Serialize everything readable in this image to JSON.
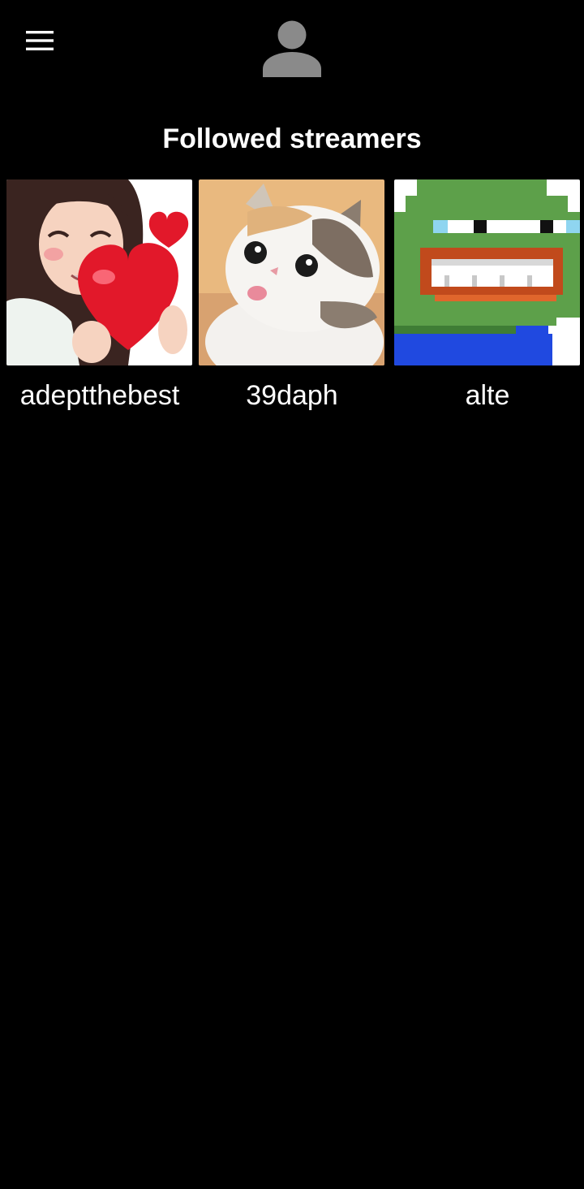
{
  "header": {
    "menu_icon": "hamburger-menu-icon",
    "avatar_icon": "user-avatar-icon",
    "avatar_color": "#8a8a8a"
  },
  "page": {
    "title": "Followed streamers",
    "background": "#000000",
    "text_color": "#ffffff"
  },
  "streamers": [
    {
      "name": "adeptthebest",
      "avatar": "cartoon-girl-holding-heart-image"
    },
    {
      "name": "39daph",
      "avatar": "calico-kitten-image"
    },
    {
      "name": "alte",
      "avatar": "pixel-art-frog-image"
    }
  ]
}
